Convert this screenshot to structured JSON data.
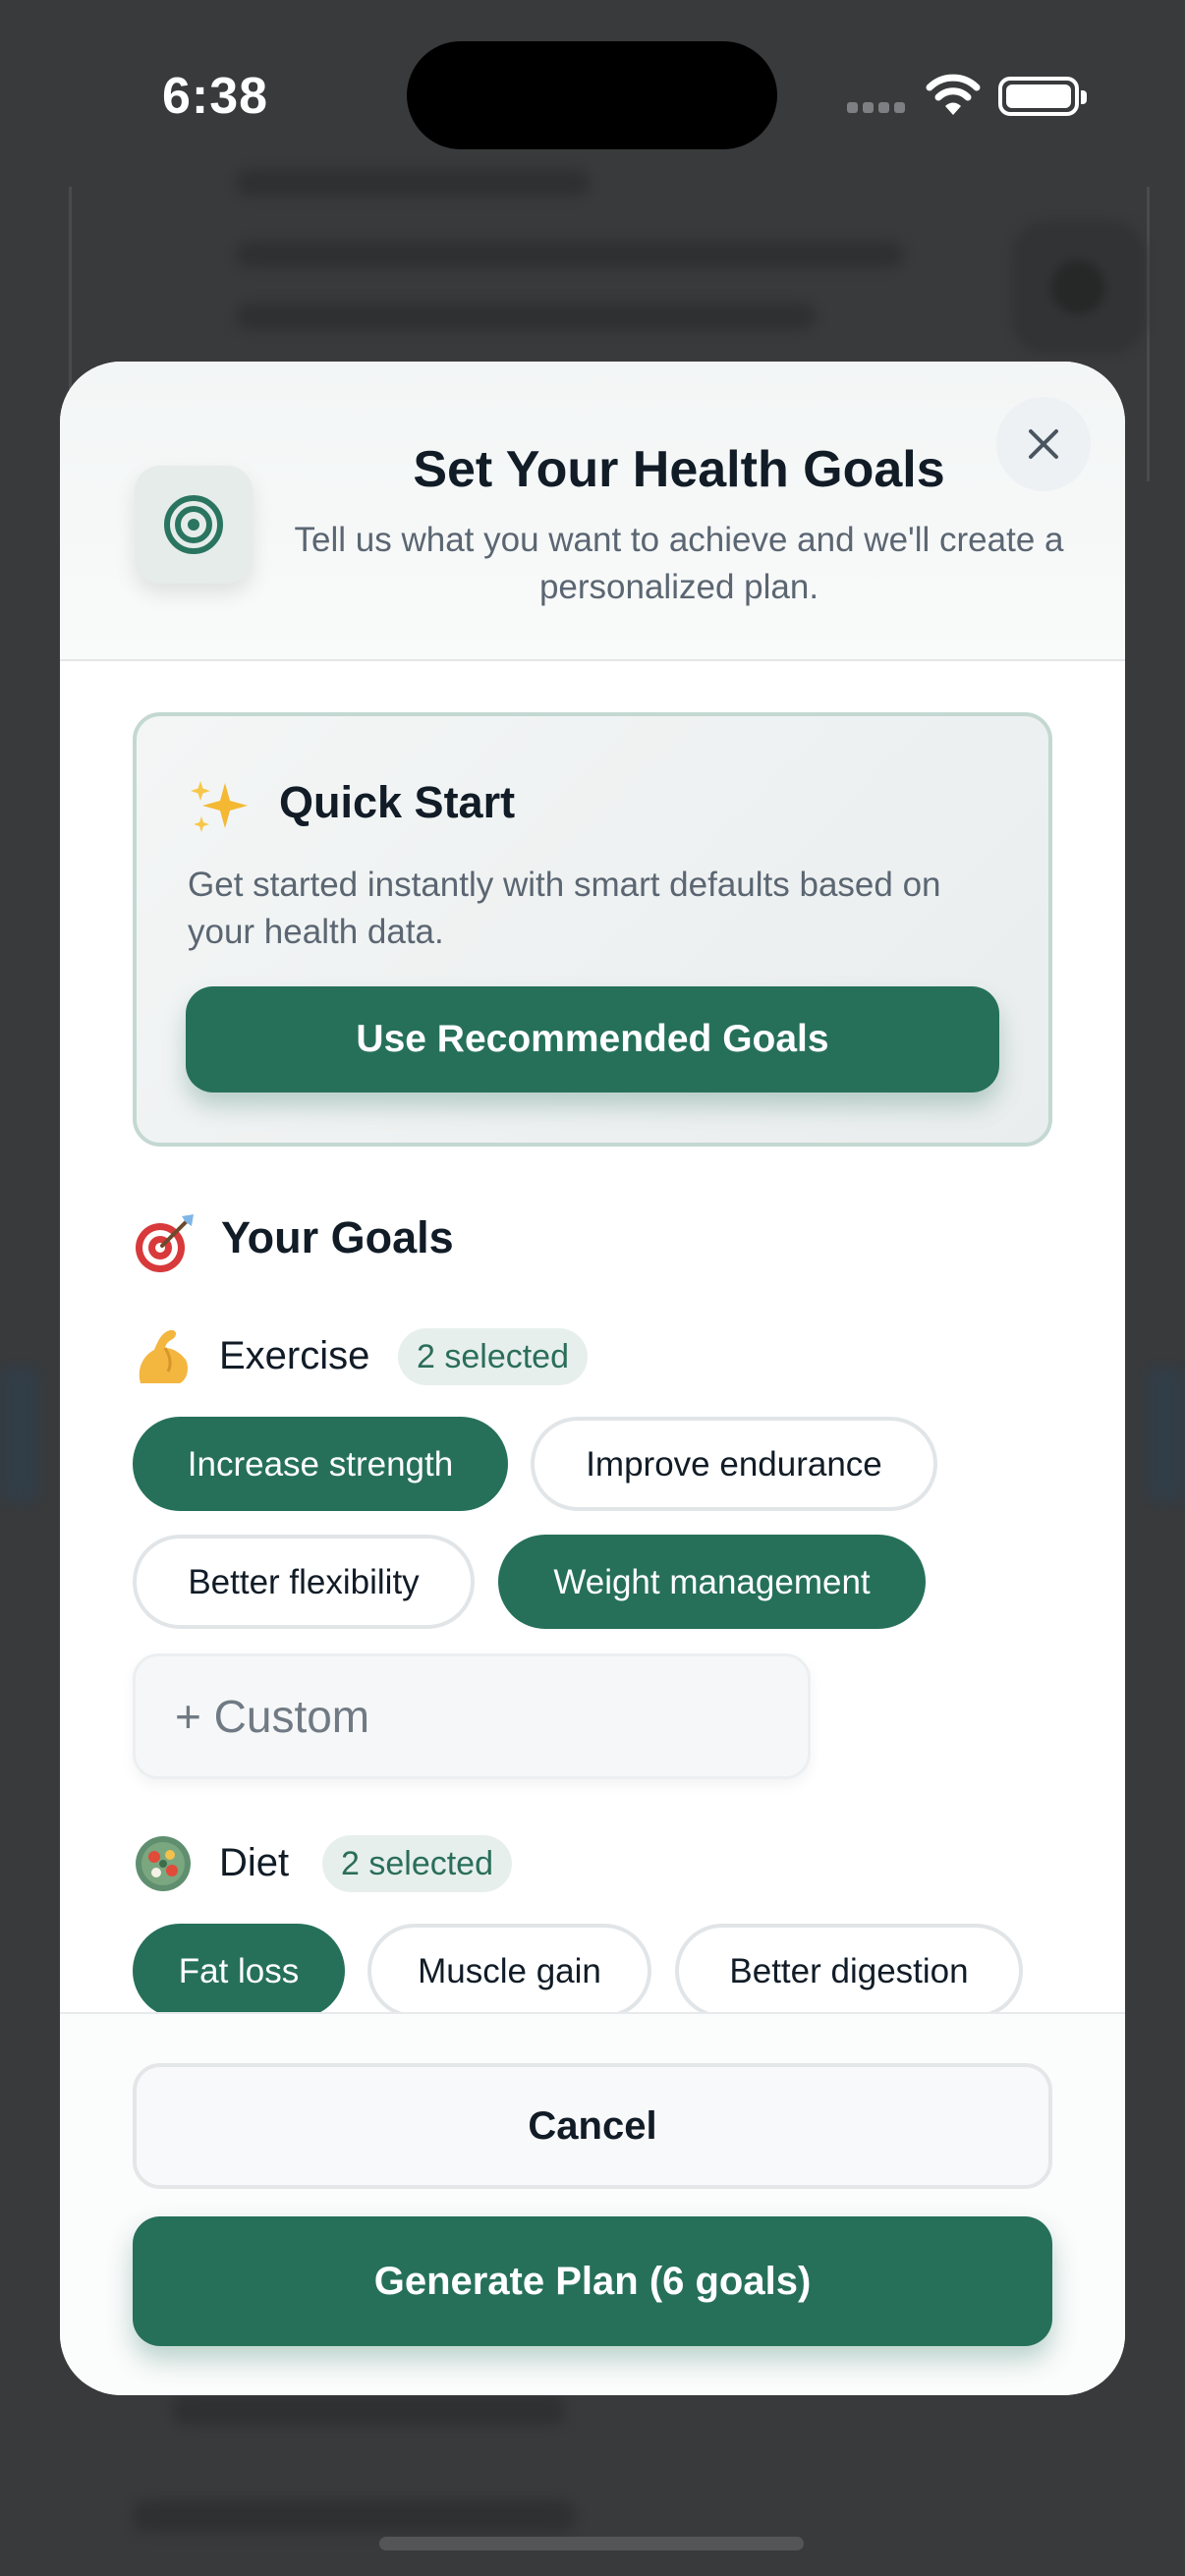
{
  "status_bar": {
    "time": "6:38"
  },
  "modal": {
    "title": "Set Your Health Goals",
    "subtitle": "Tell us what you want to achieve and we'll create a personalized plan.",
    "header_icon": "target-icon",
    "close_icon": "close-icon"
  },
  "quick_start": {
    "icon": "sparkles-icon",
    "title": "Quick Start",
    "description": "Get started instantly with smart defaults based on your health data.",
    "button_label": "Use Recommended Goals"
  },
  "goals": {
    "section_icon": "dart-icon",
    "section_title": "Your Goals",
    "exercise": {
      "icon": "flexed-biceps-icon",
      "label": "Exercise",
      "count_label": "2 selected",
      "options": [
        {
          "label": "Increase strength",
          "selected": true
        },
        {
          "label": "Improve endurance",
          "selected": false
        },
        {
          "label": "Better flexibility",
          "selected": false
        },
        {
          "label": "Weight management",
          "selected": true
        }
      ],
      "custom_placeholder": "+ Custom"
    },
    "diet": {
      "icon": "salad-bowl-icon",
      "label": "Diet",
      "count_label": "2 selected",
      "options": [
        {
          "label": "Fat loss",
          "selected": true
        },
        {
          "label": "Muscle gain",
          "selected": false
        },
        {
          "label": "Better digestion",
          "selected": false
        }
      ]
    }
  },
  "footer": {
    "cancel_label": "Cancel",
    "generate_label": "Generate Plan (6 goals)"
  },
  "colors": {
    "accent": "#26705a",
    "badge_bg": "#e7efec",
    "backdrop": "#393a3b"
  }
}
